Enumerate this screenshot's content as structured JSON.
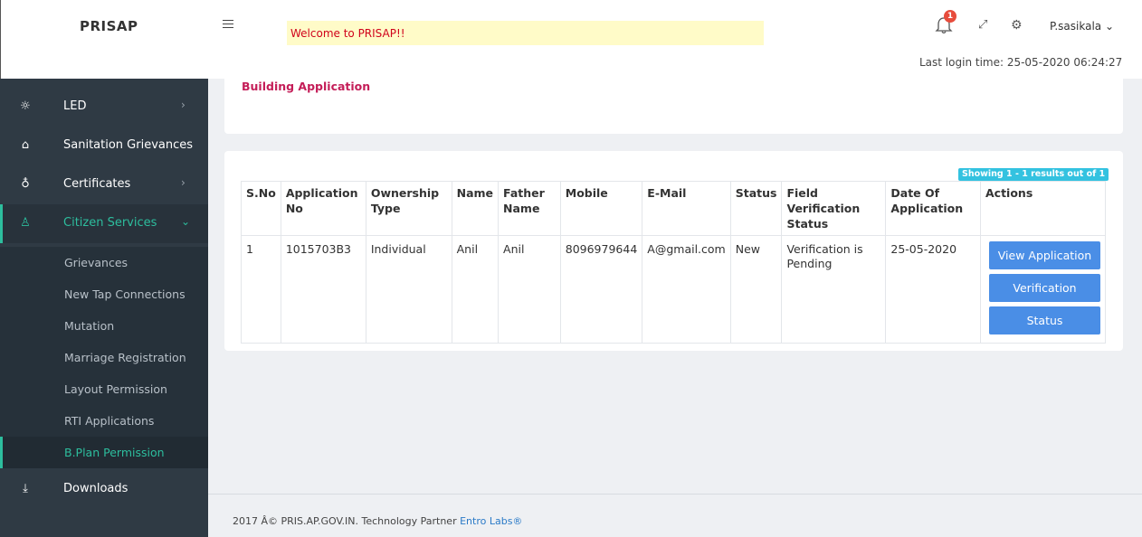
{
  "app": {
    "brand": "PRISAP",
    "welcome": "Welcome to PRISAP!!",
    "notifications": "1",
    "user": "P.sasikala",
    "last_login": "Last login time: 25-05-2020 06:24:27"
  },
  "sidebar": {
    "items": [
      {
        "label": "LED",
        "icon": "bulb-icon"
      },
      {
        "label": "Sanitation Grievances",
        "icon": "home-icon"
      },
      {
        "label": "Certificates",
        "icon": "certificate-icon"
      },
      {
        "label": "Citizen Services",
        "icon": "citizen-icon"
      },
      {
        "label": "Downloads",
        "icon": "download-icon"
      }
    ],
    "sub_items": [
      "Grievances",
      "New Tap Connections",
      "Mutation",
      "Marriage Registration",
      "Layout Permission",
      "RTI Applications",
      "B.Plan Permission"
    ]
  },
  "page": {
    "title": "Building Application",
    "results": "Showing 1 - 1 results out of 1"
  },
  "table": {
    "headers": [
      "S.No",
      "Application No",
      "Ownership Type",
      "Name",
      "Father Name",
      "Mobile",
      "E-Mail",
      "Status",
      "Field Verification Status",
      "Date Of Application",
      "Actions"
    ],
    "rows": [
      {
        "sno": "1",
        "app_no": "1015703B3",
        "ownership": "Individual",
        "name": "Anil",
        "father": "Anil",
        "mobile": "8096979644",
        "email": "A@gmail.com",
        "status": "New",
        "field_status": "Verification is Pending",
        "date": "25-05-2020"
      }
    ],
    "actions": [
      "View Application",
      "Verification",
      "Status"
    ]
  },
  "footer": {
    "text": "2017 Â© PRIS.AP.GOV.IN. Technology Partner",
    "link": "Entro Labs®"
  },
  "colors": {
    "accent": "#2dbe9e",
    "button": "#4a8ee6",
    "title": "#c41d58",
    "sidebar": "#2f3a44"
  }
}
